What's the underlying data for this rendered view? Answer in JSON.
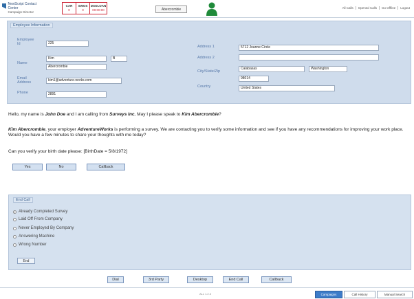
{
  "app": {
    "logo_line1": "NextScript Contact Center",
    "logo_line2": "Campaign Director"
  },
  "counters": [
    {
      "label": "CAR",
      "value": "0"
    },
    {
      "label": "SWOS",
      "value": "0"
    },
    {
      "label": "DSOLOAN",
      "value": "00:00:00"
    }
  ],
  "header": {
    "contact_name": "Abercrombie",
    "links": [
      "All Calls",
      "Opened Calls",
      "Go Offline",
      "Logout"
    ]
  },
  "employee": {
    "section_title": "Employee Information",
    "labels": {
      "employee_id": "Employee Id",
      "name": "Name",
      "email": "Email Address",
      "phone": "Phone",
      "address1": "Address 1",
      "address2": "Address 2",
      "city_state_zip": "City/State/Zip",
      "country": "Country"
    },
    "values": {
      "employee_id": "225",
      "first_name": "Kim",
      "middle_initial": "B",
      "last_name": "Abercrombie",
      "email": "kim1@adventure-works.com",
      "phone": "2891",
      "address1": "5712 Joanne Circle",
      "address2": "",
      "city": "Calabasas",
      "state": "Washington",
      "zip": "98014",
      "country": "United States"
    }
  },
  "script": {
    "line1_pre": "Hello, my name is ",
    "agent_name": "John Doe",
    "line1_mid": " and I am calling from ",
    "company": "Surveys Inc.",
    "line1_mid2": " May I please speak to ",
    "contact": "Kim Abercrombie",
    "line1_end": "?",
    "para2_contact": "Kim Abercrombie",
    "para2_pre": ", your employer ",
    "employer": "AdventureWorks",
    "para2_rest": " is performing a survey. We are contacting you to verify some information and see if you have any recommendations for improving your work place. Would you have a few minutes to share your thoughts with me today?",
    "question": "Can you verify your birth date please: [BirthDate = 5/8/1972]"
  },
  "answers": {
    "yes": "Yes",
    "no": "No",
    "callback": "Callback"
  },
  "end_call": {
    "title": "End Call",
    "options": [
      "Already Completed Survey",
      "Laid Off From Company",
      "Never Employed By Company",
      "Answering Machine",
      "Wrong Number"
    ],
    "selected_index": 0,
    "end_button": "End"
  },
  "actions": [
    "Dial",
    "3rd Party",
    "Desktop",
    "End Call",
    "Callback"
  ],
  "status": {
    "text": "ALL 1.2.3",
    "tabs": [
      "Campaigns",
      "Call History",
      "Manual Search"
    ],
    "active_tab": 0
  }
}
